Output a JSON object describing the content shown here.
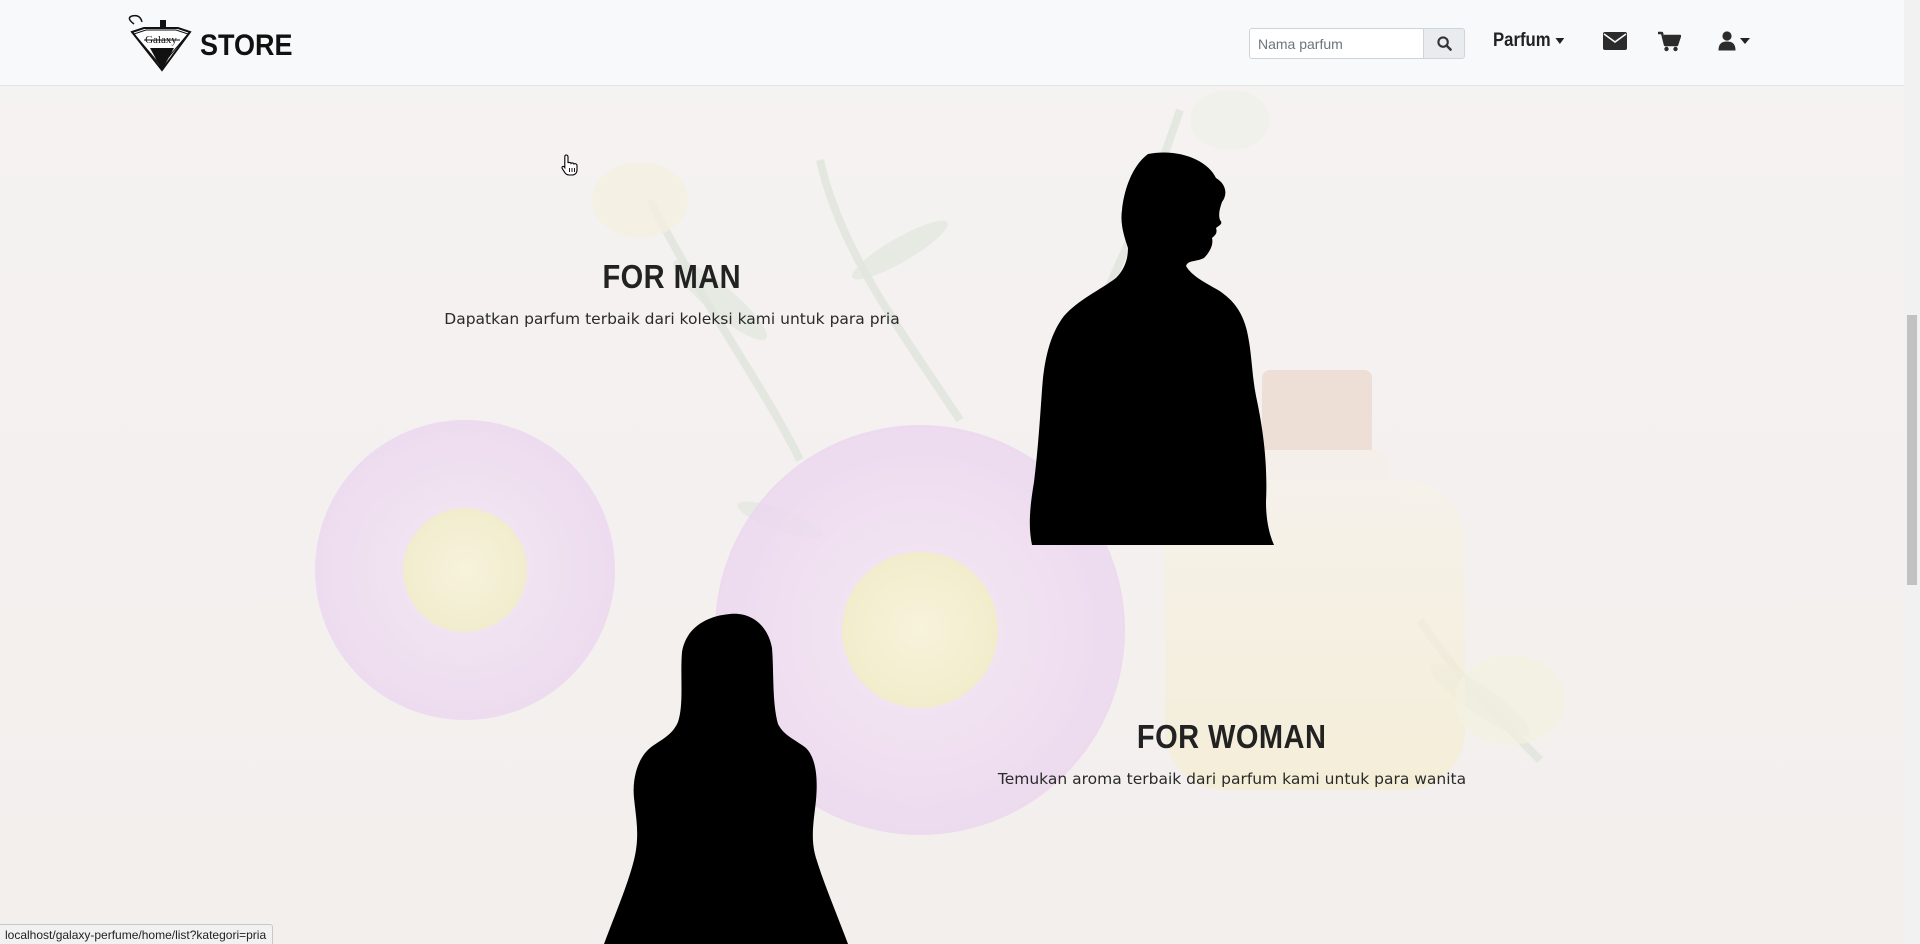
{
  "brand": {
    "logo_text": "Galaxy",
    "logo_subtext": "PERFUME",
    "name": "STORE"
  },
  "search": {
    "placeholder": "Nama parfum",
    "icon": "search-icon"
  },
  "nav": {
    "dropdown_label": "Parfum",
    "mail_icon": "envelope-icon",
    "cart_icon": "cart-icon",
    "user_icon": "user-icon"
  },
  "sections": {
    "man": {
      "title": "FOR MAN",
      "description": "Dapatkan parfum terbaik dari koleksi kami untuk para pria"
    },
    "woman": {
      "title": "FOR WOMAN",
      "description": "Temukan aroma terbaik dari parfum kami untuk para wanita"
    }
  },
  "status_bar": {
    "url": "localhost/galaxy-perfume/home/list?kategori=pria"
  },
  "colors": {
    "navbar_bg": "#f8f9fa",
    "title_text": "#222222",
    "silhouette": "#000000"
  }
}
